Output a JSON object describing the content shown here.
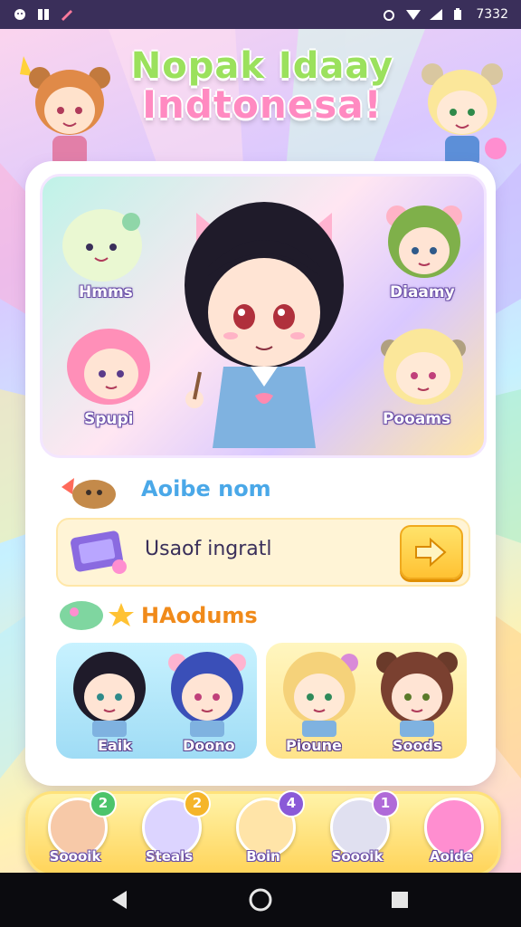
{
  "status_bar": {
    "time": "7332",
    "left_icons": [
      "face-icon",
      "sim-icon",
      "pencil-icon"
    ],
    "right_icons": [
      "alarm-icon",
      "wifi-icon",
      "signal-icon",
      "battery-icon"
    ]
  },
  "header": {
    "title_line1": "Nopak Idaay",
    "title_line2": "Indtonesa!"
  },
  "hero": {
    "characters": [
      {
        "label": "Hmms"
      },
      {
        "label": "Diaamy"
      },
      {
        "label": "Spupi"
      },
      {
        "label": "Pooams"
      }
    ]
  },
  "section1": {
    "title": "Aoibe nom"
  },
  "input_row": {
    "value": "Usaof ingratl"
  },
  "section2": {
    "title": "HAodums"
  },
  "team": {
    "members": [
      {
        "label": "Eaik"
      },
      {
        "label": "Doono"
      },
      {
        "label": "Pioune"
      },
      {
        "label": "Soods"
      }
    ]
  },
  "bottom_tabs": [
    {
      "label": "Soooik",
      "badge": "2",
      "badge_color": "#4cc46b",
      "bg": "#f7c9a8"
    },
    {
      "label": "Steals",
      "badge": "2",
      "badge_color": "#f5b52a",
      "bg": "#dcd4ff"
    },
    {
      "label": "Boin",
      "badge": "4",
      "badge_color": "#8a5ad8",
      "bg": "#ffe4a8"
    },
    {
      "label": "Soooik",
      "badge": "1",
      "badge_color": "#b06ad8",
      "bg": "#e0e0f0"
    },
    {
      "label": "Aoide",
      "badge": "",
      "badge_color": "",
      "bg": "#ff8ed0"
    }
  ],
  "colors": {
    "accent_purple": "#6b4fa8",
    "accent_yellow": "#ffc233",
    "accent_pink": "#ff8ac1",
    "accent_blue": "#4aa8e8"
  }
}
